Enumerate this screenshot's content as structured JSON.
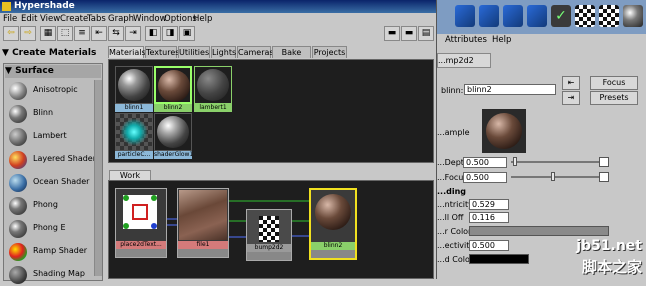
{
  "window": {
    "title": "Hypershade"
  },
  "menu": [
    "File",
    "Edit",
    "View",
    "Create",
    "Tabs",
    "Graph",
    "Window",
    "Options",
    "Help"
  ],
  "create_panel": {
    "header": "Create Materials",
    "section": "Surface",
    "items": [
      "Anisotropic",
      "Blinn",
      "Lambert",
      "Layered Shader",
      "Ocean Shader",
      "Phong",
      "Phong E",
      "Ramp Shader",
      "Shading Map"
    ]
  },
  "tabs": [
    "Materials",
    "Textures",
    "Utilities",
    "Lights",
    "Cameras",
    "Bake Sets",
    "Projects"
  ],
  "swatches": [
    "blinn1",
    "blinn2",
    "lambert1",
    "particleC...",
    "shaderGlow1"
  ],
  "work_area": {
    "tab": "Work Area",
    "nodes": [
      "place2dText...",
      "file1",
      "bump2d2",
      "blinn2"
    ]
  },
  "attribute_editor": {
    "menu": [
      "Attributes",
      "Help"
    ],
    "tab": "...mp2d2",
    "type_label": "blinn:",
    "name_value": "blinn2",
    "focus_label": "Focus",
    "presets_label": "Presets",
    "sample_label": "...ample",
    "rows": [
      {
        "label": "...Depth",
        "value": "0.500"
      },
      {
        "label": "...Focus",
        "value": "0.500"
      }
    ],
    "section": "...ding",
    "rows2": [
      {
        "label": "...ntricity",
        "value": "0.529"
      },
      {
        "label": "...ll Off",
        "value": "0.116"
      },
      {
        "label": "...r Color",
        "value": ""
      },
      {
        "label": "...ectivity",
        "value": "0.500"
      },
      {
        "label": "...d Color",
        "value": ""
      }
    ]
  },
  "watermark": {
    "line1": "jb51.net",
    "line2": "脚本之家"
  }
}
